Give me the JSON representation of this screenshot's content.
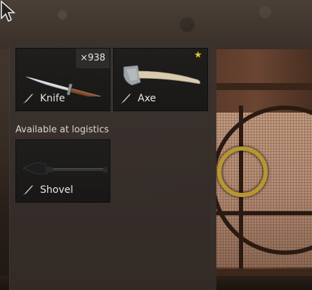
{
  "inventory": {
    "items": [
      {
        "name": "Knife",
        "count": "×938",
        "kind_icon": "knife-icon",
        "art": "knife-art"
      },
      {
        "name": "Axe",
        "favorite": true,
        "kind_icon": "knife-icon",
        "art": "axe-art"
      }
    ],
    "section_label": "Available at logistics",
    "logistics_items": [
      {
        "name": "Shovel",
        "kind_icon": "knife-icon",
        "art": "shovel-art"
      }
    ]
  },
  "colors": {
    "panel_bg": "#3a322e",
    "tile_bg": "#1c1b1a",
    "star": "#e8c828",
    "text": "#eae6de"
  }
}
